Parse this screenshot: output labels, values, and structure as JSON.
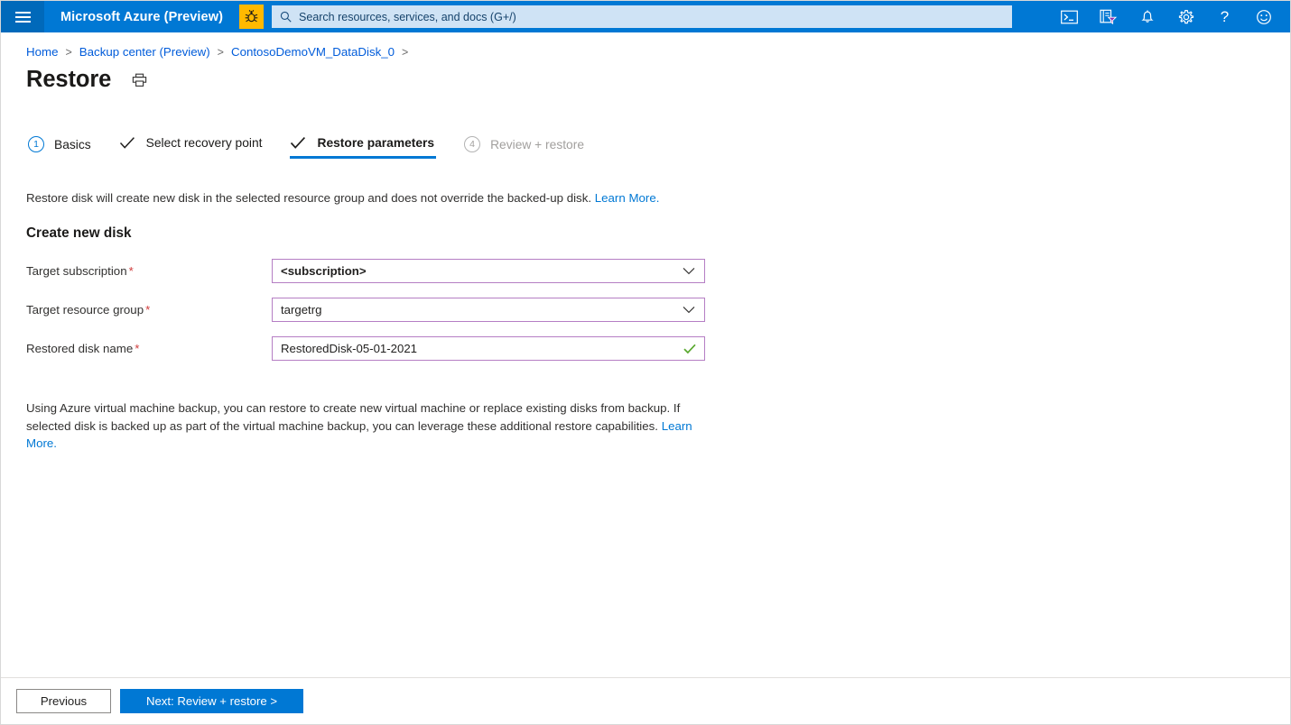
{
  "topbar": {
    "menu_icon": "hamburger-icon",
    "brand": "Microsoft Azure (Preview)",
    "bug_icon": "bug-icon",
    "search": {
      "icon": "search-icon",
      "placeholder": "Search resources, services, and docs (G+/)"
    },
    "icons": [
      {
        "name": "cloud-shell-icon",
        "title": "Cloud Shell"
      },
      {
        "name": "directory-subscription-filter-icon",
        "title": "Directories + subscriptions"
      },
      {
        "name": "notifications-bell-icon",
        "title": "Notifications"
      },
      {
        "name": "settings-gear-icon",
        "title": "Settings"
      },
      {
        "name": "help-question-icon",
        "title": "Help",
        "glyph": "?"
      },
      {
        "name": "feedback-smiley-icon",
        "title": "Feedback"
      }
    ],
    "accent_color": "#0078d4",
    "bug_color": "#ffb900"
  },
  "breadcrumb": {
    "items": [
      "Home",
      "Backup center (Preview)",
      "ContosoDemoVM_DataDisk_0"
    ],
    "separator": ">",
    "trailing_separator": ">"
  },
  "header": {
    "title": "Restore",
    "print_icon": "print-icon"
  },
  "wizard": {
    "steps": [
      {
        "marker": "1",
        "type": "number",
        "label": "Basics",
        "state": "enabled"
      },
      {
        "marker": "check",
        "type": "check",
        "label": "Select recovery point",
        "state": "complete"
      },
      {
        "marker": "check",
        "type": "check",
        "label": "Restore parameters",
        "state": "active"
      },
      {
        "marker": "4",
        "type": "number",
        "label": "Review + restore",
        "state": "disabled"
      }
    ],
    "active_color": "#0078d4"
  },
  "main": {
    "description": "Restore disk will create new disk in the selected resource group and does not override the backed-up disk.",
    "description_link": "Learn More.",
    "section_title": "Create new disk",
    "fields": [
      {
        "label": "Target subscription",
        "required": true,
        "control": "dropdown",
        "value": "<subscription>",
        "bold_value": true,
        "icon": "chevron-down-icon"
      },
      {
        "label": "Target resource group",
        "required": true,
        "control": "dropdown",
        "value": "targetrg",
        "bold_value": false,
        "icon": "chevron-down-icon"
      },
      {
        "label": "Restored disk name",
        "required": true,
        "control": "text",
        "value": "RestoredDisk-05-01-2021",
        "bold_value": false,
        "icon": "valid-check-icon"
      }
    ],
    "required_marker": "*",
    "field_border_color": "#b57ec4",
    "valid_color": "#5aa82f",
    "note_text": "Using Azure virtual machine backup, you can restore to create new virtual machine or replace existing disks from backup. If selected disk is backed up as part of the virtual machine backup, you can leverage these additional restore capabilities.",
    "note_link": "Learn More."
  },
  "footer": {
    "previous_label": "Previous",
    "next_label": "Next: Review + restore >"
  }
}
